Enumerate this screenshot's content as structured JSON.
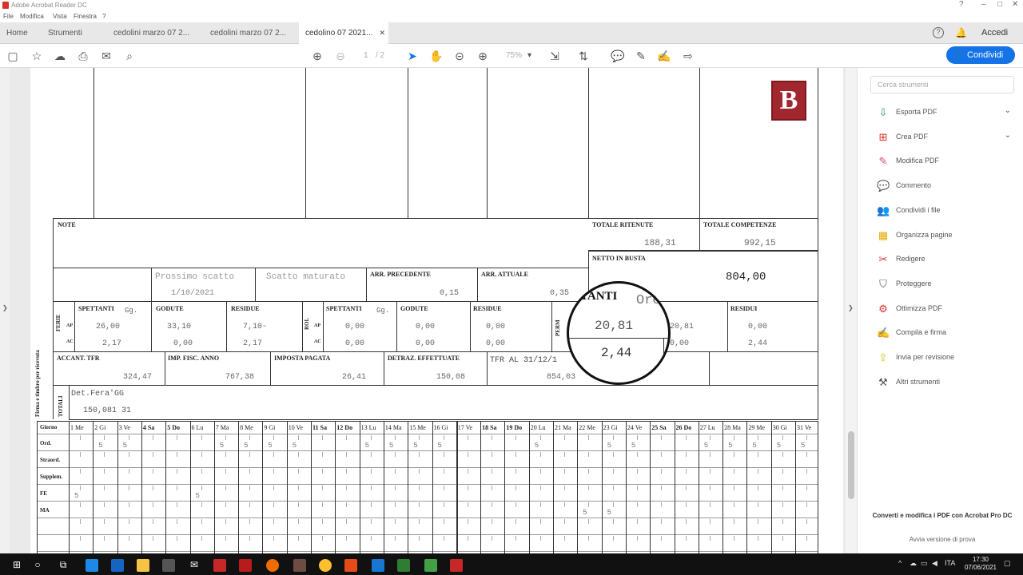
{
  "window": {
    "title": "Adobe Acrobat Reader DC",
    "controls": [
      "?",
      "–",
      "□",
      "✕"
    ]
  },
  "menu": [
    "File",
    "Modifica",
    "Vista",
    "Finestra",
    "?"
  ],
  "tabs": [
    {
      "label": "Home",
      "active": false
    },
    {
      "label": "Strumenti",
      "active": false
    },
    {
      "label": "cedolini marzo 07 2...",
      "active": false
    },
    {
      "label": "cedolini marzo 07 2...",
      "active": false
    },
    {
      "label": "cedolino 07 2021...",
      "active": true
    }
  ],
  "header": {
    "login": "Accedi"
  },
  "toolbar": {
    "page_current": "1",
    "page_total": "/ 2",
    "zoom": "75%",
    "share_label": "Condividi"
  },
  "doc": {
    "labels": {
      "note": "NOTE",
      "totale_ritenute": "TOTALE RITENUTE",
      "totale_competenze": "TOTALE COMPETENZE",
      "netto_in_busta": "NETTO IN BUSTA",
      "prossimo_scatto": "Prossimo scatto",
      "scatto_maturato": "Scatto maturato",
      "arr_precedente": "ARR. PRECEDENTE",
      "arr_attuale": "ARR. ATTUALE",
      "spettanti": "SPETTANTI",
      "godute": "GODUTE",
      "residue": "RESIDUE",
      "gg": "Gg.",
      "residui": "RESIDUI",
      "acconti": "ACCANT. TFR",
      "imp_fisc": "IMP. FISC. ANNO",
      "imposta_pagata": "IMPOSTA PAGATA",
      "detraz": "DETRAZ. EFFETTUATE",
      "tfr_al": "TFR AL 31/12/1",
      "ferie": "FERIE",
      "rol": "ROL",
      "perm": "PERM",
      "ap": "AP",
      "ac": "AC",
      "totali": "TOTALI",
      "firma": "Firma e timbro per ricevuta"
    },
    "values": {
      "totale_ritenute": "188,31",
      "totale_competenze": "992,15",
      "netto_in_busta": "804,00",
      "prossimo_scatto_date": "1/10/2021",
      "arr_precedente": "0,15",
      "arr_attuale": "0,35",
      "ferie_spettanti_ap": "26,00",
      "ferie_godute_ap": "33,10",
      "ferie_residue_ap": "7,10-",
      "ferie_spettanti_ac": "2,17",
      "ferie_godute_ac": "0,00",
      "ferie_residue_ac": "2,17",
      "rol_spettanti_ap": "0,00",
      "rol_godute_ap": "0,00",
      "rol_residue_ap": "0,00",
      "rol_spettanti_ac": "0,00",
      "rol_godute_ac": "0,00",
      "rol_residue_ac": "0,00",
      "perm_spettanti": "20,81",
      "perm_spettanti2": "2,44",
      "perm_godute": "20,81",
      "perm_godute2": "0,00",
      "perm_residui": "0,00",
      "perm_residui2": "2,44",
      "acconti": "324,47",
      "imp_fisc": "767,38",
      "imposta_pagata": "26,41",
      "detraz": "150,08",
      "tfr": "854,03",
      "tot_label": "Det.Fera'GG",
      "tot_value": "150,081 31"
    },
    "magnifier": {
      "t1": "TANTI",
      "t2": "Ore",
      "t3": "20,81",
      "t4": "2,44"
    },
    "calendar": {
      "header_label": "Giorno",
      "days": [
        "1 Me",
        "2 Gi",
        "3 Ve",
        "4 Sa",
        "5 Do",
        "6 Lu",
        "7 Ma",
        "8 Me",
        "9 Gi",
        "10 Ve",
        "11 Sa",
        "12 Do",
        "13 Lu",
        "14 Ma",
        "15 Me",
        "16 Gi",
        "17 Ve",
        "18 Sa",
        "19 Do",
        "20 Lu",
        "21 Ma",
        "22 Me",
        "23 Gi",
        "24 Ve",
        "25 Sa",
        "26 Do",
        "27 Lu",
        "28 Ma",
        "29 Me",
        "30 Gi",
        "31 Ve"
      ],
      "rows": [
        "Ord.",
        "Straord.",
        "Supplem.",
        "FE",
        "MA"
      ],
      "ord_values": [
        "",
        "5",
        "5",
        "",
        "",
        "",
        "5",
        "5",
        "5",
        "5",
        "",
        "",
        "5",
        "5",
        "5",
        "5",
        "",
        "",
        "",
        "5",
        "",
        "",
        "5",
        "5",
        "",
        "",
        "5",
        "5",
        "5",
        "5",
        "5"
      ],
      "fe_values": [
        "5",
        "",
        "",
        "",
        "",
        "5"
      ],
      "ma_values": {
        "21": "5",
        "22": "5"
      }
    }
  },
  "right_pane": {
    "search_placeholder": "Cerca strumenti",
    "tools": [
      {
        "label": "Esporta PDF",
        "icon": "export-pdf-icon",
        "color": "#2da05a",
        "chevron": true
      },
      {
        "label": "Crea PDF",
        "icon": "create-pdf-icon",
        "color": "#d9302a",
        "chevron": true
      },
      {
        "label": "Modifica PDF",
        "icon": "edit-pdf-icon",
        "color": "#e0457b",
        "chevron": false
      },
      {
        "label": "Commento",
        "icon": "comment-icon",
        "color": "#f0b400",
        "chevron": false
      },
      {
        "label": "Condividi i file",
        "icon": "share-file-icon",
        "color": "#6a5acd",
        "chevron": false
      },
      {
        "label": "Organizza pagine",
        "icon": "organize-pages-icon",
        "color": "#e8a800",
        "chevron": false
      },
      {
        "label": "Redigere",
        "icon": "redact-icon",
        "color": "#d9302a",
        "chevron": false
      },
      {
        "label": "Proteggere",
        "icon": "protect-icon",
        "color": "#555555",
        "chevron": false
      },
      {
        "label": "Ottimizza PDF",
        "icon": "optimize-pdf-icon",
        "color": "#d9302a",
        "chevron": false
      },
      {
        "label": "Compila e firma",
        "icon": "fill-sign-icon",
        "color": "#555555",
        "chevron": false
      },
      {
        "label": "Invia per revisione",
        "icon": "send-review-icon",
        "color": "#d4c200",
        "chevron": false
      },
      {
        "label": "Altri strumenti",
        "icon": "more-tools-icon",
        "color": "#555555",
        "chevron": false
      }
    ],
    "promo": "Converti e modifica i PDF con Acrobat Pro DC",
    "promo_link": "Avvia versione di prova"
  },
  "taskbar": {
    "time": "17:30",
    "date": "07/06/2021"
  }
}
